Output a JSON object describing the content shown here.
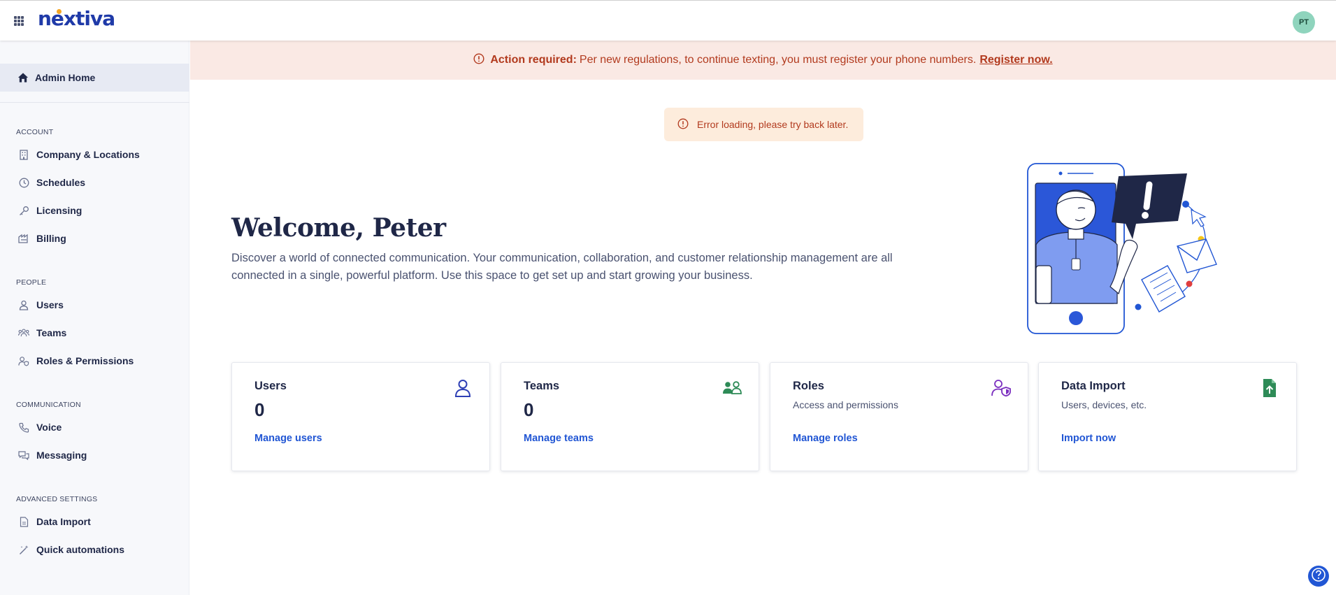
{
  "header": {
    "logo_text": "nextiva",
    "avatar_initials": "PT",
    "apps_icon": "grid-apps-icon"
  },
  "sidebar": {
    "home_label": "Admin Home",
    "sections": [
      {
        "title": "ACCOUNT",
        "items": [
          "Company & Locations",
          "Schedules",
          "Licensing",
          "Billing"
        ]
      },
      {
        "title": "PEOPLE",
        "items": [
          "Users",
          "Teams",
          "Roles & Permissions"
        ]
      },
      {
        "title": "COMMUNICATION",
        "items": [
          "Voice",
          "Messaging"
        ]
      },
      {
        "title": "ADVANCED SETTINGS",
        "items": [
          "Data Import",
          "Quick automations"
        ]
      }
    ]
  },
  "banner": {
    "strong": "Action required:",
    "text": "Per new regulations, to continue texting, you must register your phone numbers.",
    "link": "Register now."
  },
  "toast": {
    "text": "Error loading, please try back later."
  },
  "welcome": {
    "title": "Welcome, Peter",
    "description": "Discover a world of connected communication. Your communication, collaboration, and customer relationship management are all connected in a single, powerful platform. Use this space to get set up and start growing your business."
  },
  "cards": [
    {
      "title": "Users",
      "count": "0",
      "subtitle": "",
      "link": "Manage users",
      "icon": "user-icon"
    },
    {
      "title": "Teams",
      "count": "0",
      "subtitle": "",
      "link": "Manage teams",
      "icon": "team-icon"
    },
    {
      "title": "Roles",
      "count": "",
      "subtitle": "Access and permissions",
      "link": "Manage roles",
      "icon": "user-shield-icon"
    },
    {
      "title": "Data Import",
      "count": "",
      "subtitle": "Users, devices, etc.",
      "link": "Import now",
      "icon": "file-upload-icon"
    }
  ],
  "colors": {
    "brand": "#1f3aa8",
    "link": "#2156d4",
    "alert_text": "#b23a1e",
    "banner_bg": "#fae9e4",
    "toast_bg": "#fdecdc",
    "avatar_bg": "#8fd4bd",
    "teams_icon": "#2e8b57",
    "roles_icon": "#7b2fbf"
  }
}
